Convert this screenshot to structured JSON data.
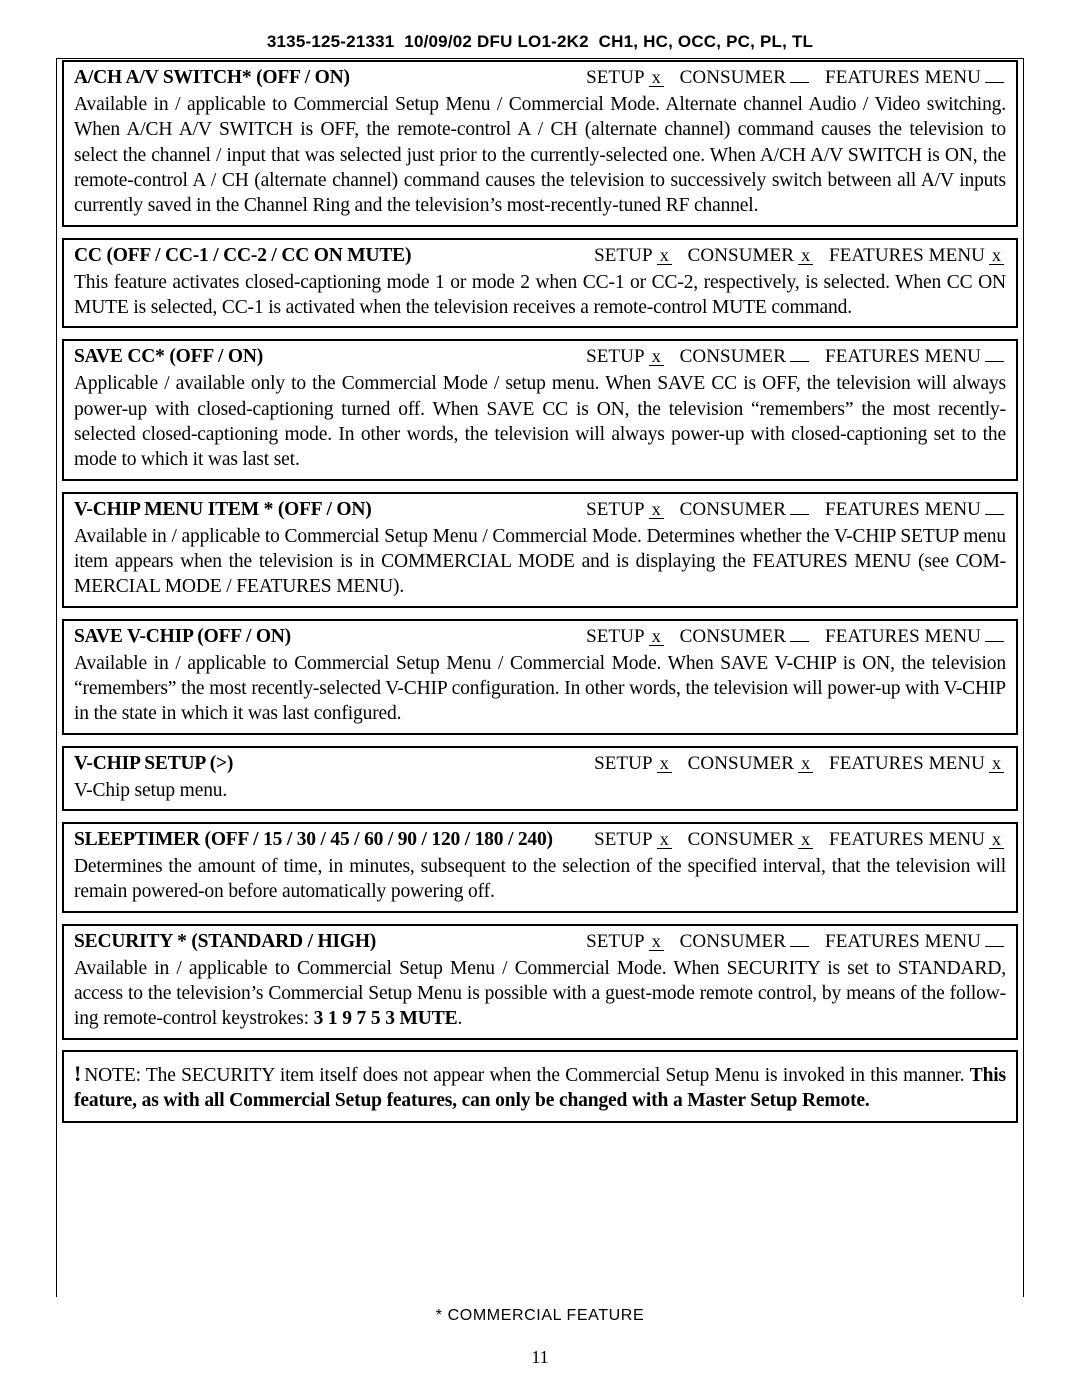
{
  "header": {
    "doc_number": "3135-125-21331",
    "date": "10/09/02",
    "doc_code": "DFU LO1-2K2",
    "models": "CH1, HC, OCC, PC, PL, TL"
  },
  "menu_labels": {
    "setup": "SETUP",
    "consumer": "CONSUMER",
    "features_menu": "FEATURES MENU"
  },
  "sections": [
    {
      "title": "A/CH A/V SWITCH* (OFF / ON)",
      "marks": {
        "setup": "x",
        "consumer": "",
        "features_menu": ""
      },
      "body": "Available in / applicable to Commercial Setup Menu / Commercial Mode.  Alternate channel Audio / Video switching.  When A/CH A/V SWITCH is OFF, the remote-control A / CH (alternate channel) command causes the television to select the channel / input that was selected just prior to the currently-selected one.  When A/CH A/V SWITCH is ON, the remote-control A / CH (alternate channel) command causes the television to successively switch between all A/V inputs currently saved in the Channel Ring and the television’s most-recently-tuned RF channel."
    },
    {
      "title": "CC (OFF / CC-1 / CC-2 / CC ON MUTE)",
      "marks": {
        "setup": "x",
        "consumer": "x",
        "features_menu": "x"
      },
      "body": "This feature activates closed-captioning mode 1 or mode 2 when CC-1 or CC-2, respectively, is selected.  When CC ON MUTE is selected, CC-1 is activated when the television receives a remote-control MUTE command."
    },
    {
      "title": "SAVE CC* (OFF / ON)",
      "marks": {
        "setup": "x",
        "consumer": "",
        "features_menu": ""
      },
      "body": "Applicable / available only to the Commercial Mode / setup menu.  When SAVE CC is OFF, the television will always power-up with closed-captioning turned off.  When SAVE CC is ON, the television “remembers” the most recently-selected closed-captioning mode.  In other words, the television will always power-up with closed-captioning set to the mode to which it was last set."
    },
    {
      "title": "V-CHIP MENU ITEM * (OFF / ON)",
      "marks": {
        "setup": "x",
        "consumer": "",
        "features_menu": ""
      },
      "body": "Available in / applicable to Commercial Setup Menu / Commercial Mode.  Determines whether the V-CHIP SETUP menu item appears when the television is in COMMERCIAL MODE and is displaying the FEATURES MENU (see COM-MERCIAL MODE / FEATURES MENU)."
    },
    {
      "title": "SAVE V-CHIP (OFF / ON)",
      "marks": {
        "setup": "x",
        "consumer": "",
        "features_menu": ""
      },
      "body": "Available in / applicable to Commercial Setup Menu / Commercial Mode.  When SAVE V-CHIP is ON, the television “remembers” the most recently-selected V-CHIP configuration.  In other words, the television will power-up with V-CHIP in the state in which it was last configured."
    },
    {
      "title": "V-CHIP SETUP  (>)",
      "marks": {
        "setup": "x",
        "consumer": "x",
        "features_menu": "x"
      },
      "body": "V-Chip setup menu."
    },
    {
      "title": "SLEEPTIMER (OFF / 15 / 30 / 45 / 60 / 90 / 120 / 180 / 240)",
      "marks": {
        "setup": "x",
        "consumer": "x",
        "features_menu": "x"
      },
      "body": "Determines the amount of time, in minutes, subsequent to the selection of the specified interval, that the television will remain powered-on before automatically powering off."
    },
    {
      "title": "SECURITY * (STANDARD / HIGH)",
      "marks": {
        "setup": "x",
        "consumer": "",
        "features_menu": ""
      },
      "body_pre": "Available in / applicable to Commercial Setup Menu / Commercial Mode.  When SECURITY is set to STANDARD, access to the television’s Commercial Setup Menu is possible with a guest-mode remote control, by means of the follow-ing remote-control keystrokes: ",
      "body_bold": "3 1 9 7 5 3 MUTE",
      "body_post": "."
    }
  ],
  "note": {
    "bang": "!",
    "text_normal": "NOTE:  The SECURITY item itself does not appear when the Commercial Setup Menu is invoked in this manner.  ",
    "text_bold": "This feature, as with all Commercial Setup features, can only be changed with a Master Setup Remote."
  },
  "footer": {
    "commercial_feature_note": "* COMMERCIAL FEATURE",
    "page_number": "11"
  }
}
